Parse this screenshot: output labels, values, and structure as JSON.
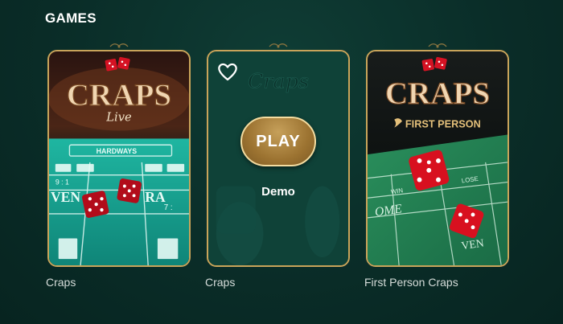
{
  "section": {
    "title": "GAMES"
  },
  "games": [
    {
      "name": "Craps",
      "logo_main": "CRAPS",
      "logo_sub": "Live"
    },
    {
      "name": "Craps",
      "play_label": "PLAY",
      "demo_label": "Demo",
      "favorite_icon": "heart-outline-icon"
    },
    {
      "name": "First Person Craps",
      "logo_main": "CRAPS",
      "logo_sub": "FIRST PERSON"
    }
  ],
  "colors": {
    "background": "#0a2d28",
    "card_border": "#c9a45a",
    "table_felt": "#1aa08e",
    "play_button": "#9c7331",
    "dice": "#c8101e"
  }
}
